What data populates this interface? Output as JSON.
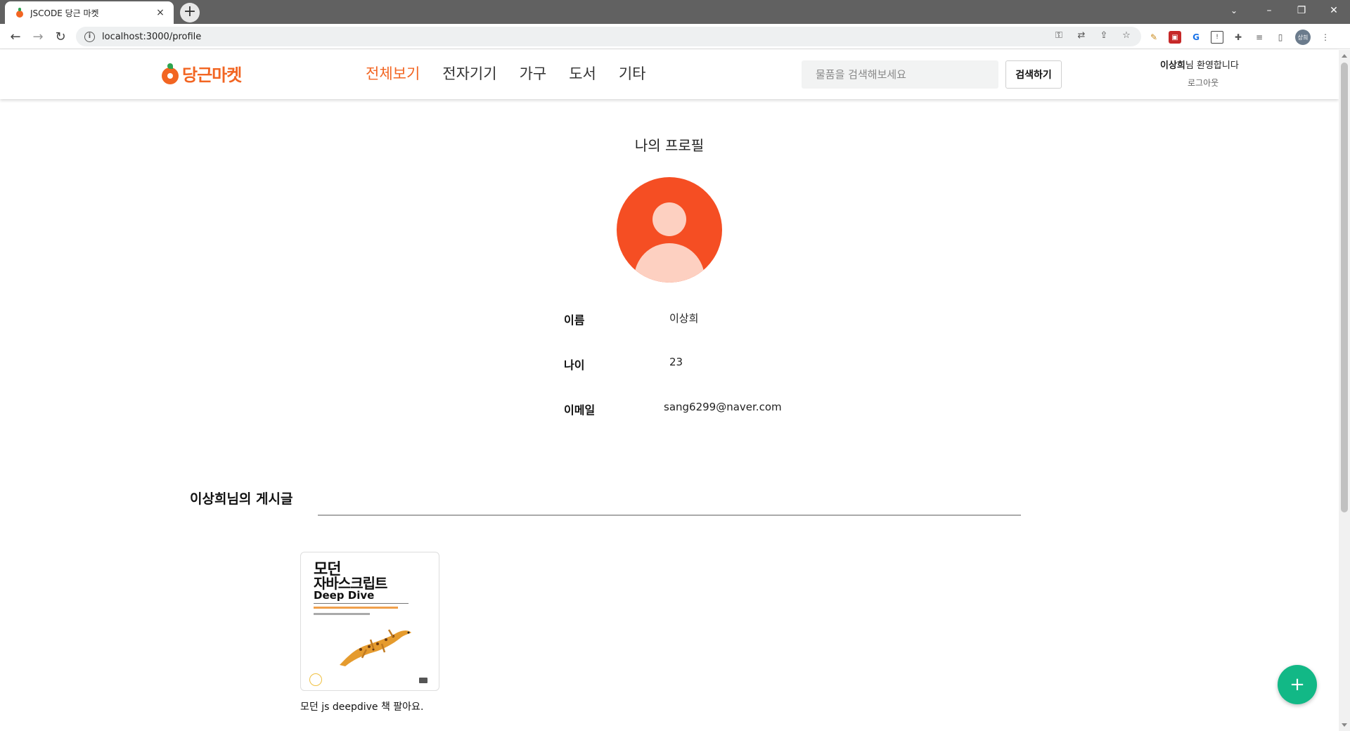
{
  "browser": {
    "tab_title": "JSCODE 당근 마켓",
    "tab_close": "×",
    "new_tab": "+",
    "url": "localhost:3000/profile",
    "avatar_chip": "상희"
  },
  "header": {
    "logo_text": "당근마켓",
    "categories": [
      "전체보기",
      "전자기기",
      "가구",
      "도서",
      "기타"
    ],
    "active_category": "전체보기",
    "search_placeholder": "물품을 검색해보세요",
    "search_button": "검색하기",
    "welcome_name": "이상희",
    "welcome_suffix": "님 환영합니다",
    "logout": "로그아웃"
  },
  "profile": {
    "title": "나의 프로필",
    "rows": [
      {
        "label": "이름",
        "value": "이상희"
      },
      {
        "label": "나이",
        "value": "23"
      },
      {
        "label": "이메일",
        "value": "sang6299@naver.com"
      }
    ]
  },
  "posts": {
    "section_title": "이상희님의 게시글",
    "items": [
      {
        "image_title_line1": "모던",
        "image_title_line2": "자바스크립트",
        "image_title_line3": "Deep Dive",
        "caption": "모던 js deepdive 책 팔아요."
      }
    ]
  },
  "fab": {
    "label": "+",
    "color": "#12b886"
  },
  "colors": {
    "brand": "#f26522",
    "avatar_bg": "#f54e23",
    "avatar_fg": "#fdd0c1"
  }
}
